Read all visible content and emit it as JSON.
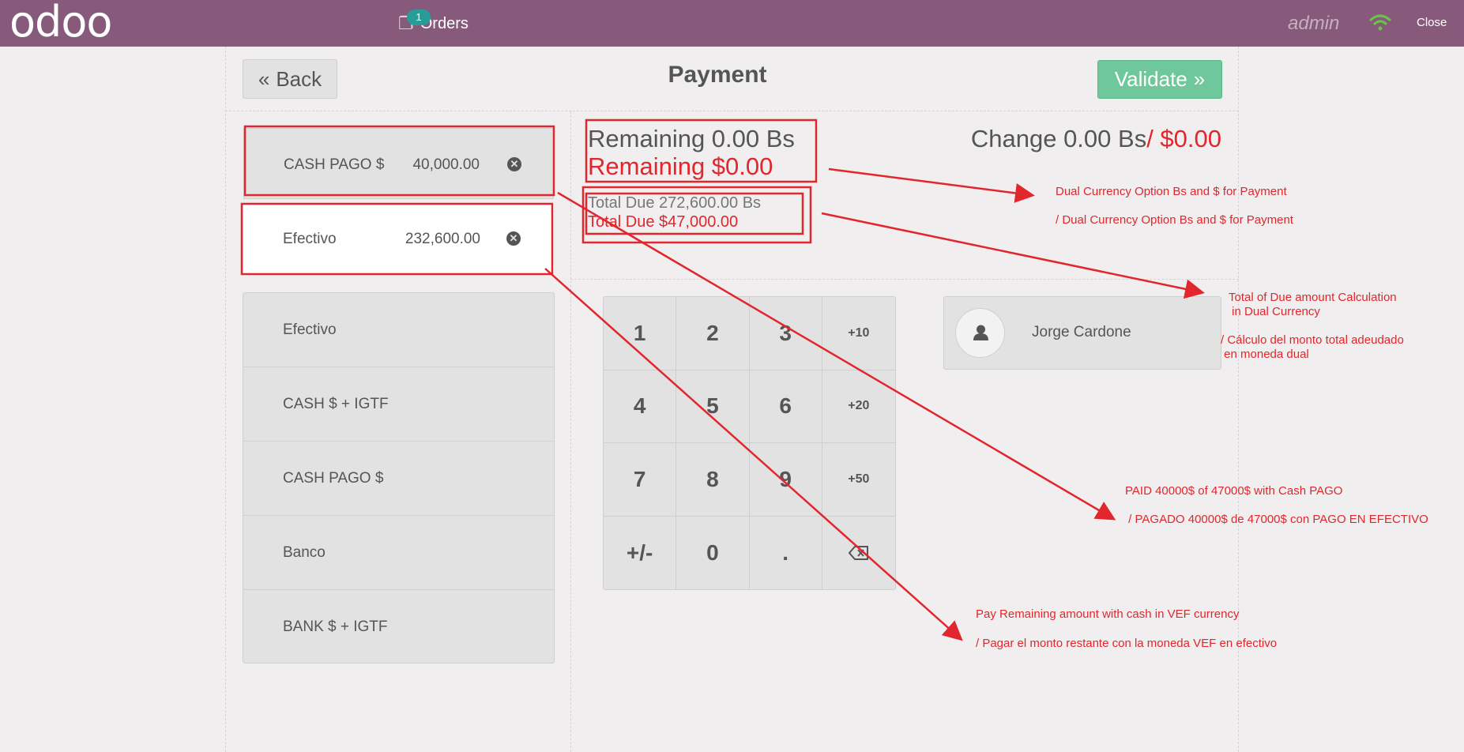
{
  "topbar": {
    "logo": "odoo",
    "orders_label": "Orders",
    "orders_count": "1",
    "user": "admin",
    "close_label": "Close"
  },
  "header": {
    "back_label": "Back",
    "title": "Payment",
    "validate_label": "Validate"
  },
  "paymentlines": [
    {
      "name": "CASH PAGO $",
      "amount": "40,000.00"
    },
    {
      "name": "Efectivo",
      "amount": "232,600.00"
    }
  ],
  "payment_methods": [
    "Efectivo",
    "CASH $ + IGTF",
    "CASH PAGO $",
    "Banco",
    "BANK $ + IGTF"
  ],
  "summary": {
    "remaining_bs": "Remaining 0.00 Bs",
    "remaining_usd": "Remaining  $0.00",
    "total_due_bs": "Total Due  272,600.00 Bs",
    "total_due_usd": "Total Due  $47,000.00",
    "change_bs": "Change 0.00 Bs",
    "change_usd": "/ $0.00"
  },
  "numpad": [
    "1",
    "2",
    "3",
    "+10",
    "4",
    "5",
    "6",
    "+20",
    "7",
    "8",
    "9",
    "+50",
    "+/-",
    "0",
    ".",
    "backspace"
  ],
  "customer": {
    "name": "Jorge Cardone"
  },
  "annotations": {
    "dual_currency_1": "Dual Currency Option Bs and $ for Payment",
    "dual_currency_2": "/  Dual Currency Option Bs and $ for Payment",
    "total_due_1": "Total of Due amount Calculation",
    "total_due_2": " in Dual Currency",
    "total_due_3": "/  Cálculo del monto total adeudado",
    "total_due_4": " en moneda dual",
    "paid_1": "PAID 40000$ of 47000$ with Cash PAGO",
    "paid_2": " / PAGADO 40000$ de 47000$ con PAGO EN EFECTIVO",
    "remaining_1": "Pay Remaining amount with cash in VEF currency",
    "remaining_2": "/ Pagar el monto restante con la moneda VEF en efectivo"
  },
  "colors": {
    "topbar": "#875a7b",
    "validate": "#6ec89b",
    "annotation": "#e2262d",
    "badge": "#279d9a"
  }
}
